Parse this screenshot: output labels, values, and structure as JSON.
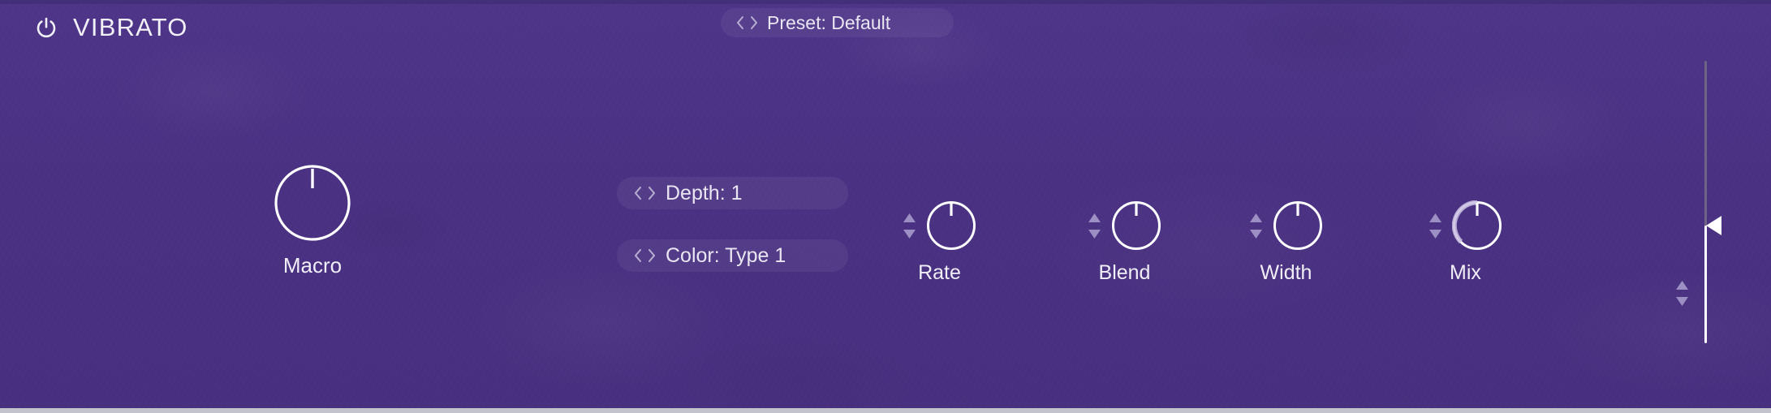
{
  "window": {
    "plugin_title": "VIBRATO",
    "background_color": "#4a3183",
    "accent_color": "#ffffff",
    "stepper_color": "#9b8fc4",
    "track_color": "#6e6484"
  },
  "header": {
    "power_icon": "power-icon",
    "title": "VIBRATO"
  },
  "preset": {
    "label": "Preset: Default",
    "prev_icon": "chevron-left-icon",
    "next_icon": "chevron-right-icon"
  },
  "macro": {
    "label": "Macro",
    "value_angle": 0
  },
  "selectors": [
    {
      "name": "depth",
      "label": "Depth: 1",
      "prev_icon": "chevron-left-icon",
      "next_icon": "chevron-right-icon"
    },
    {
      "name": "color",
      "label": "Color: Type 1",
      "prev_icon": "chevron-left-icon",
      "next_icon": "chevron-right-icon"
    }
  ],
  "knobs": [
    {
      "name": "rate",
      "label": "Rate",
      "value_angle": 0,
      "arc": false
    },
    {
      "name": "blend",
      "label": "Blend",
      "value_angle": 0,
      "arc": false
    },
    {
      "name": "width",
      "label": "Width",
      "value_angle": 0,
      "arc": false
    },
    {
      "name": "mix",
      "label": "Mix",
      "value_angle": 0,
      "arc": true
    }
  ],
  "stepper": {
    "up_icon": "triangle-up-icon",
    "down_icon": "triangle-down-icon"
  },
  "slider": {
    "name": "output-slider",
    "handle_icon": "triangle-left-handle-icon",
    "up_icon": "triangle-up-icon",
    "down_icon": "triangle-down-icon"
  }
}
